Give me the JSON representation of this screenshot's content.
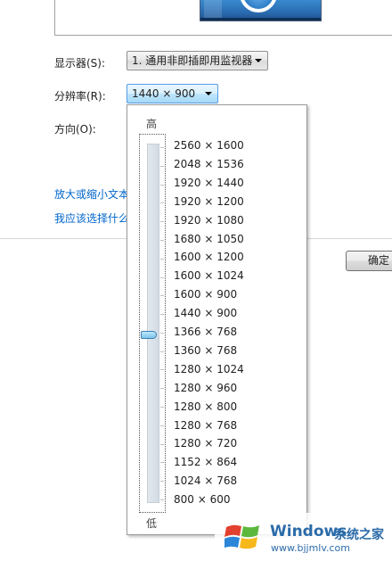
{
  "monitor_label": "显示器(S):",
  "monitor_value": "1. 通用非即插即用监视器",
  "resolution_label": "分辨率(R):",
  "resolution_value": "1440 × 900",
  "orientation_label": "方向(O):",
  "links": {
    "enlarge_text": "放大或缩小文本",
    "which_to_choose": "我应该选择什么"
  },
  "ok_button": "确定",
  "dropdown": {
    "high_label": "高",
    "low_label": "低",
    "selected": "1440 × 900",
    "slider_position_fraction": 0.53,
    "options": [
      "2560 × 1600",
      "2048 × 1536",
      "1920 × 1440",
      "1920 × 1200",
      "1920 × 1080",
      "1680 × 1050",
      "1600 × 1200",
      "1600 × 1024",
      "1600 × 900",
      "1440 × 900",
      "1366 × 768",
      "1360 × 768",
      "1280 × 1024",
      "1280 × 960",
      "1280 × 800",
      "1280 × 768",
      "1280 × 720",
      "1152 × 864",
      "1024 × 768",
      "800 × 600"
    ]
  },
  "watermark": {
    "title": "Windows",
    "chinese": "系统之家",
    "url": "www.bjjmlv.com"
  },
  "colors": {
    "link": "#0066cc",
    "watermark": "#2b6ba9",
    "combo_active_border": "#569de5"
  }
}
